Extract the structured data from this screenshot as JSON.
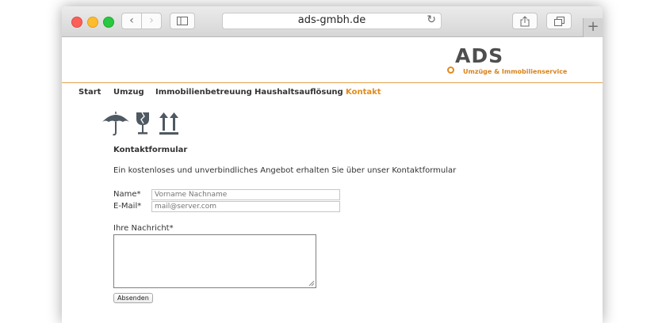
{
  "browser": {
    "url": "ads-gmbh.de",
    "back_glyph": "‹",
    "forward_glyph": "›",
    "reload_glyph": "↻",
    "new_tab_glyph": "+"
  },
  "logo": {
    "brand": "ADS",
    "tagline": "Umzüge & Immobilienservice",
    "brand_color": "#4e4e4e",
    "accent_color": "#e08b1a"
  },
  "menu": {
    "items": [
      "Start",
      "Umzug",
      "Immobilienbetreuung",
      "Haushaltsauflösung",
      "Kontakt"
    ],
    "active": "Kontakt",
    "active_color": "#e08b1a"
  },
  "icons": [
    "umbrella-icon",
    "fragile-glass-icon",
    "this-side-up-icon"
  ],
  "form": {
    "title": "Kontaktformular",
    "intro": "Ein kostenloses und unverbindliches Angebot erhalten Sie über unser Kontaktformular",
    "name_label": "Name*",
    "name_placeholder": "Vorname Nachname",
    "email_label": "E-Mail*",
    "email_placeholder": "mail@server.com",
    "message_label": "Ihre Nachricht*",
    "submit_label": "Absenden"
  }
}
